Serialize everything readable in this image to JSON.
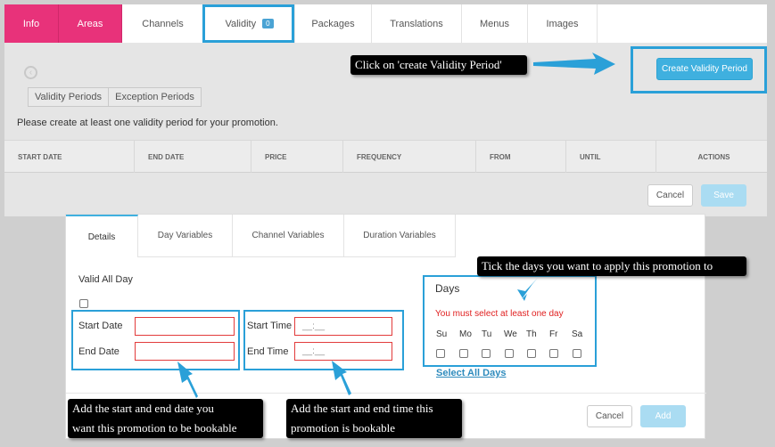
{
  "tabs": [
    {
      "label": "Info"
    },
    {
      "label": "Areas"
    },
    {
      "label": "Channels"
    },
    {
      "label": "Validity",
      "badge": "0"
    },
    {
      "label": "Packages"
    },
    {
      "label": "Translations"
    },
    {
      "label": "Menus"
    },
    {
      "label": "Images"
    }
  ],
  "validity": {
    "segments": [
      "Validity Periods",
      "Exception Periods"
    ],
    "hint": "Please create at least one validity period for your promotion.",
    "create_button": "Create Validity Period",
    "columns": [
      "START DATE",
      "END DATE",
      "PRICE",
      "FREQUENCY",
      "FROM",
      "UNTIL",
      "ACTIONS"
    ],
    "cancel_label": "Cancel",
    "save_label": "Save"
  },
  "details": {
    "tabs": [
      "Details",
      "Day Variables",
      "Channel Variables",
      "Duration Variables"
    ],
    "valid_all_day": "Valid All Day",
    "start_date_label": "Start Date",
    "end_date_label": "End Date",
    "start_time_label": "Start Time",
    "end_time_label": "End Time",
    "time_placeholder": "__:__",
    "days_title": "Days",
    "days_error": "You must select at least one day",
    "days": [
      "Su",
      "Mo",
      "Tu",
      "We",
      "Th",
      "Fr",
      "Sa"
    ],
    "select_all": "Select All Days",
    "cancel_label": "Cancel",
    "add_label": "Add"
  },
  "annotations": {
    "create_callout": "Click on 'create Validity Period'",
    "days_callout": "Tick the days you want to apply this promotion to",
    "date_callout_line1": "Add the start and end date you",
    "date_callout_line2": "want this promotion to be bookable",
    "time_callout_line1": "Add the start and end time this",
    "time_callout_line2": "promotion is bookable"
  },
  "colors": {
    "accent_pink": "#e8327a",
    "primary_blue": "#3fb0df",
    "highlight_blue": "#2aa0d8",
    "error_red": "#e02020"
  }
}
